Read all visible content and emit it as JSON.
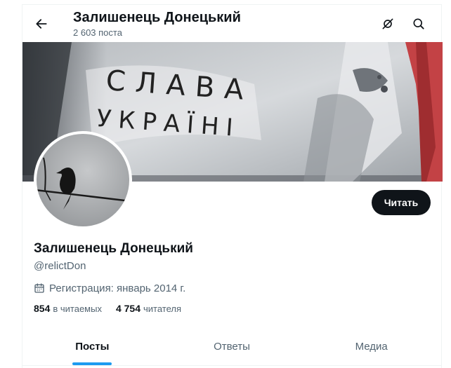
{
  "header": {
    "title": "Залишенець Донецький",
    "post_count": "2 603 поста"
  },
  "banner": {
    "graffiti_line1": "СЛАВА",
    "graffiti_line2": "УКРАЇНІ"
  },
  "profile": {
    "follow_label": "Читать",
    "name": "Залишенець Донецький",
    "handle": "@relictDon",
    "joined": "Регистрация: январь 2014 г.",
    "following_count": "854",
    "following_label": "в читаемых",
    "followers_count": "4 754",
    "followers_label": "читателя"
  },
  "tabs": [
    {
      "label": "Посты",
      "active": true
    },
    {
      "label": "Ответы",
      "active": false
    },
    {
      "label": "Медиа",
      "active": false
    }
  ],
  "colors": {
    "accent": "#1d9bf0",
    "text_primary": "#0f1419",
    "text_secondary": "#536471"
  },
  "icons": [
    "back-arrow-icon",
    "satellite-off-icon",
    "search-icon",
    "calendar-icon"
  ]
}
